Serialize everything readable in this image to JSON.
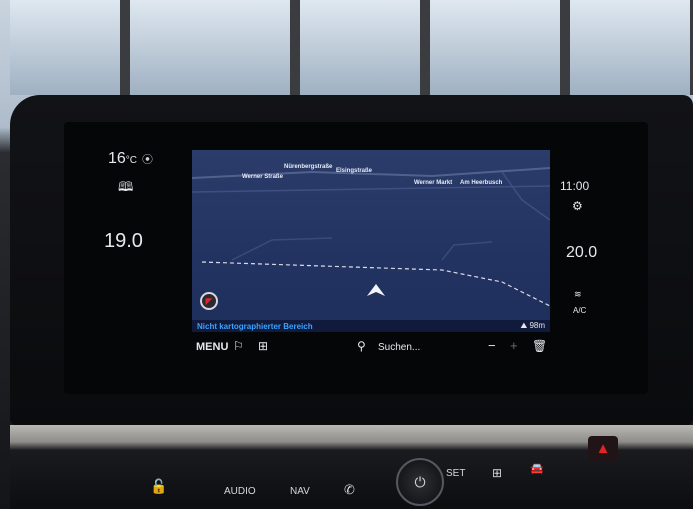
{
  "left": {
    "temp": "16",
    "temp_unit": "°C",
    "pin_icon": "location-pin-icon",
    "book_icon": "book-icon",
    "setpoint": "19.0"
  },
  "map": {
    "streets": [
      "Nürenbergstraße",
      "Elsingstraße",
      "Werner Straße",
      "Werner Markt",
      "Am Heerbusch"
    ],
    "status": "Nicht kartographierter Bereich",
    "distance": "98m"
  },
  "toolbar": {
    "menu": "MENU",
    "search": "Suchen..."
  },
  "right": {
    "time": "11:00",
    "setpoint": "20.0",
    "ac": "A/C"
  },
  "buttons": {
    "audio": "AUDIO",
    "nav": "NAV",
    "set": "SET"
  },
  "colors": {
    "map_bg": "#223362",
    "status_text": "#3ba3ff",
    "hazard": "#e1242a"
  }
}
